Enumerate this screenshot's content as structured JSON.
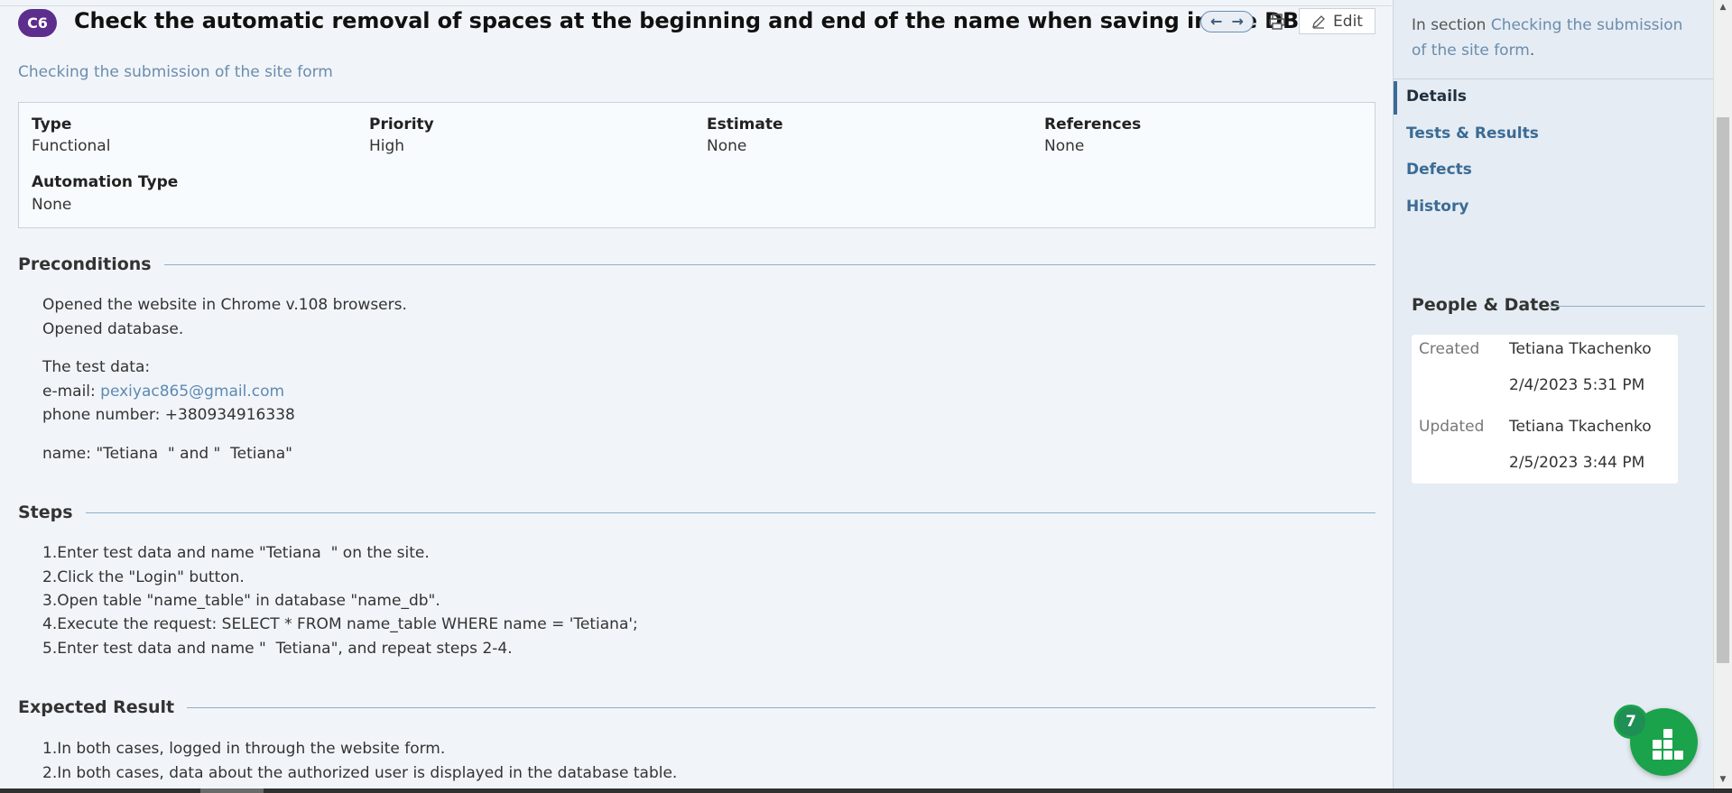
{
  "header": {
    "case_id": "C6",
    "title": "Check the automatic removal of spaces at the beginning and end of the name when saving in the DB.",
    "prev_icon": "arrow-left-icon",
    "next_icon": "arrow-right-icon",
    "print_icon": "printer-icon",
    "edit_label": "Edit"
  },
  "section_link": "Checking the submission of the site form",
  "fields": {
    "type_label": "Type",
    "type_value": "Functional",
    "priority_label": "Priority",
    "priority_value": "High",
    "estimate_label": "Estimate",
    "estimate_value": "None",
    "references_label": "References",
    "references_value": "None",
    "automation_label": "Automation Type",
    "automation_value": "None"
  },
  "preconditions": {
    "heading": "Preconditions",
    "line1": "Opened the website in Chrome v.108 browsers.",
    "line2": "Opened database.",
    "line3": "The test data:",
    "email_prefix": "e-mail: ",
    "email": "pexiyac865@gmail.com",
    "phone": "phone number: +380934916338",
    "name": "name: \"Tetiana  \" and \"  Tetiana\""
  },
  "steps": {
    "heading": "Steps",
    "items": [
      "1.Enter test data and name \"Tetiana  \" on the site.",
      "2.Click the \"Login\" button.",
      "3.Open table \"name_table\" in database \"name_db\".",
      "4.Execute the request: SELECT * FROM name_table WHERE name = 'Tetiana';",
      "5.Enter test data and name \"  Tetiana\", and repeat steps 2-4."
    ]
  },
  "expected": {
    "heading": "Expected Result",
    "items": [
      "1.In both cases, logged in through the website form.",
      "2.In both cases, data about the authorized user is displayed in the database table."
    ]
  },
  "sidebar": {
    "in_section_prefix": "In section ",
    "in_section_link": "Checking the submission of the site form",
    "in_section_suffix": ".",
    "tabs": [
      "Details",
      "Tests & Results",
      "Defects",
      "History"
    ],
    "people_heading": "People & Dates",
    "created_label": "Created",
    "created_by": "Tetiana Tkachenko",
    "created_date": "2/4/2023 5:31 PM",
    "updated_label": "Updated",
    "updated_by": "Tetiana Tkachenko",
    "updated_date": "2/5/2023 3:44 PM"
  },
  "widget": {
    "badge_count": "7",
    "icon": "app-grid-icon"
  },
  "colors": {
    "accent": "#3b6b95",
    "badge": "#5d2e8c",
    "widget": "#1aa34a",
    "link": "#6b8cad"
  }
}
